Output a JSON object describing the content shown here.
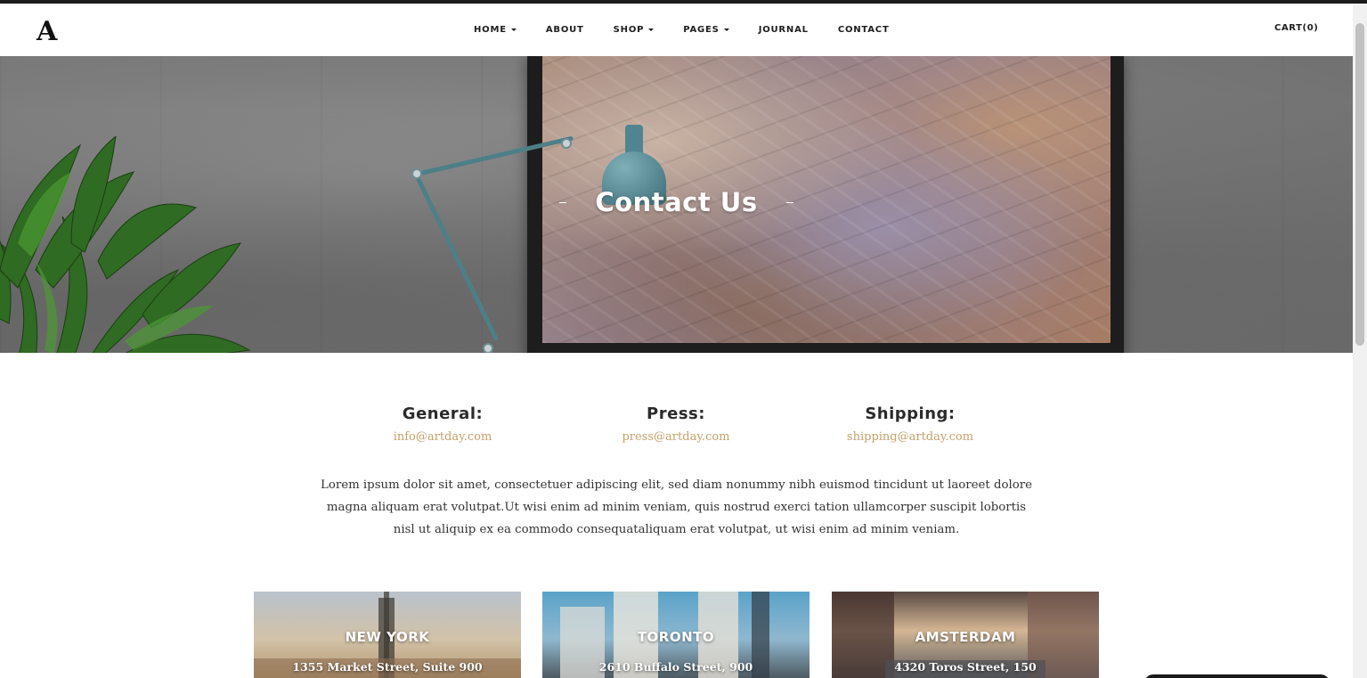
{
  "header": {
    "logo": "A",
    "nav": [
      {
        "label": "HOME",
        "dropdown": true
      },
      {
        "label": "ABOUT",
        "dropdown": false
      },
      {
        "label": "SHOP",
        "dropdown": true
      },
      {
        "label": "PAGES",
        "dropdown": true
      },
      {
        "label": "JOURNAL",
        "dropdown": false
      },
      {
        "label": "CONTACT",
        "dropdown": false
      }
    ],
    "cart": "CART(0)"
  },
  "hero": {
    "title": "Contact Us"
  },
  "contacts": [
    {
      "label": "General:",
      "email": "info@artday.com"
    },
    {
      "label": "Press:",
      "email": "press@artday.com"
    },
    {
      "label": "Shipping:",
      "email": "shipping@artday.com"
    }
  ],
  "intro": "Lorem ipsum dolor sit amet, consectetuer adipiscing elit, sed diam nonummy nibh euismod tincidunt ut laoreet dolore magna aliquam erat volutpat.Ut wisi enim ad minim veniam, quis nostrud exerci tation ullamcorper suscipit lobortis nisl ut aliquip ex ea commodo consequataliquam erat volutpat, ut wisi enim ad minim veniam.",
  "locations": [
    {
      "city": "NEW YORK",
      "address": "1355 Market Street, Suite 900"
    },
    {
      "city": "TORONTO",
      "address": "2610 Buffalo Street, 900"
    },
    {
      "city": "AMSTERDAM",
      "address": "4320 Toros Street, 150"
    }
  ],
  "colors": {
    "accent": "#c6a16b",
    "text": "#2b2b2b",
    "topline": "#1b1b1b"
  }
}
